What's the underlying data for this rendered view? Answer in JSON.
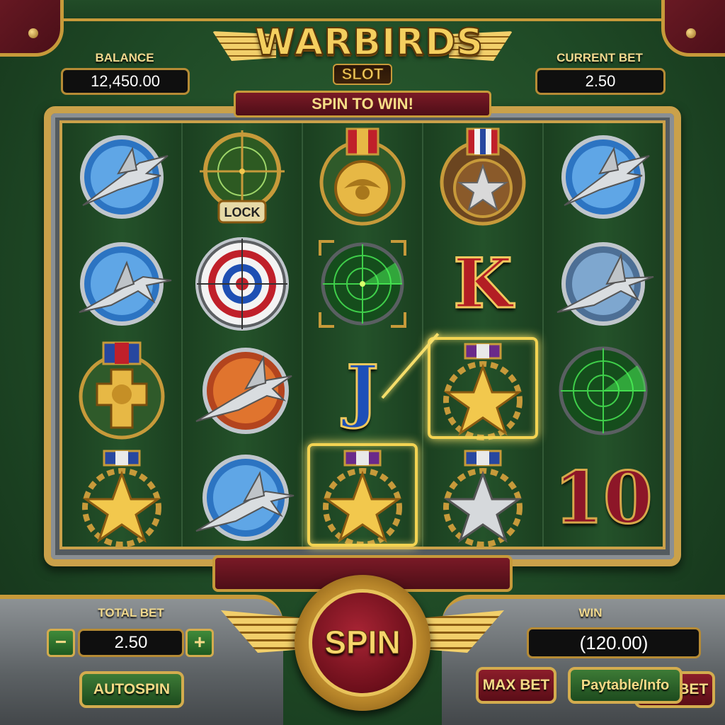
{
  "logo": {
    "title": "WARBIRDS",
    "subtitle": "SLOT"
  },
  "hud": {
    "balance_label": "BALANCE",
    "balance_value": "12,450.00",
    "current_bet_label": "CURRENT BET",
    "current_bet_value": "2.50"
  },
  "banner": "SPIN TO WIN!",
  "reels": [
    [
      "jet-blue",
      "target-lock",
      "gold-medal-eagle",
      "bronze-star-medal"
    ],
    [
      "jet-blue",
      "roundel-target",
      "radar-scope",
      "K"
    ],
    [
      "cross-medal",
      "jet-orange",
      "J",
      "gold-star-medal"
    ],
    [
      "gold-star-medal",
      "jet-blue",
      "gold-star-medal",
      "silver-star-medal"
    ],
    [
      "jet-blue",
      "jet-blue",
      "radar-scope",
      "10"
    ]
  ],
  "symbols": {
    "lock_label": "LOCK",
    "K": "K",
    "J": "J",
    "ten": "10"
  },
  "controls": {
    "total_bet_label": "TOTAL BET",
    "total_bet_value": "2.50",
    "minus": "−",
    "plus": "+",
    "autospin": "AUTOSPIN",
    "spin": "SPIN",
    "win_label": "WIN",
    "win_value": "(120.00)",
    "max_bet": "MAX BET",
    "paytable": "Paytable/Info"
  },
  "colors": {
    "gold": "#c79a3a",
    "maroon": "#6b1a24",
    "felt": "#1f4a26"
  }
}
